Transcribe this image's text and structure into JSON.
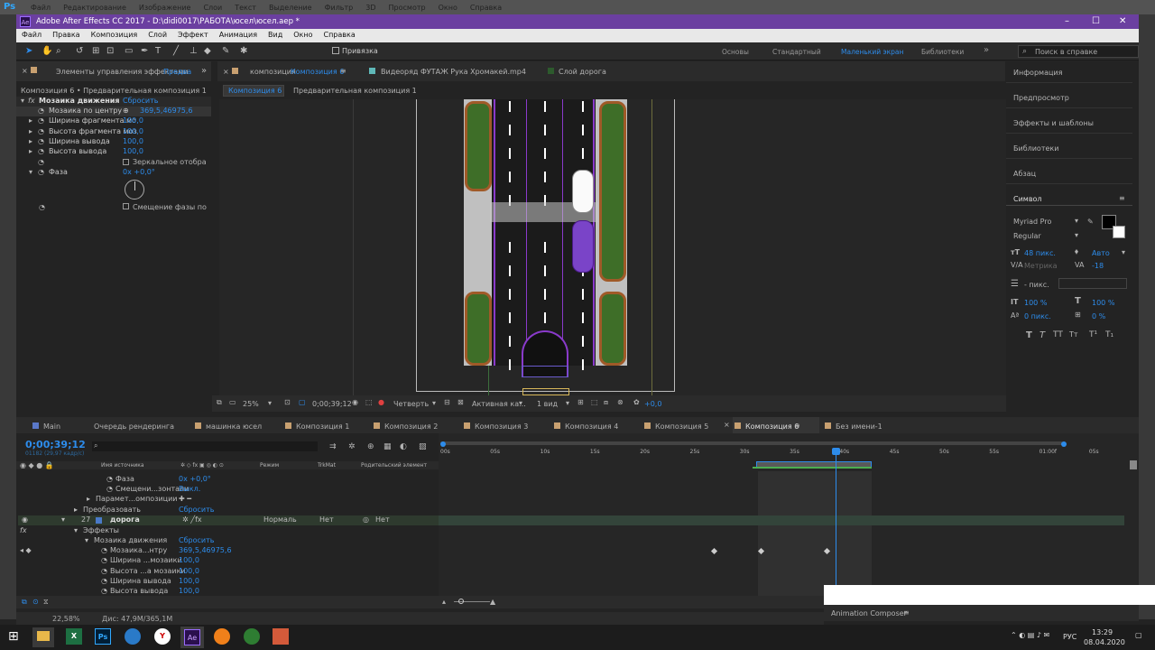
{
  "ps": {
    "logo": "Ps",
    "menu": [
      "Файл",
      "Редактирование",
      "Изображение",
      "Слои",
      "Текст",
      "Выделение",
      "Фильтр",
      "3D",
      "Просмотр",
      "Окно",
      "Справка"
    ]
  },
  "window": {
    "app_badge": "Ae",
    "title": "Adobe After Effects CC 2017 - D:\\didi0017\\РАБОТА\\юсел\\юсел.aep *"
  },
  "menu": [
    "Файл",
    "Правка",
    "Композиция",
    "Слой",
    "Эффект",
    "Анимация",
    "Вид",
    "Окно",
    "Справка"
  ],
  "toolbar": {
    "snap": "Привязка",
    "workspaces": [
      "Основы",
      "Стандартный",
      "Маленький экран",
      "Библиотеки"
    ],
    "active_workspace": "Маленький экран",
    "search_placeholder": "Поиск в справке"
  },
  "effects_panel": {
    "tab": "Элементы управления эффектами",
    "tab_target": "Предва",
    "breadcrumb": "Композиция 6 • Предварительная композиция 1",
    "effect_name": "Мозаика движения",
    "reset": "Сбросить",
    "props": [
      {
        "name": "Мозаика по центру",
        "value": "369,5,46975,6"
      },
      {
        "name": "Ширина фрагмента мо",
        "value": "100,0"
      },
      {
        "name": "Высота фрагмента моз",
        "value": "100,0"
      },
      {
        "name": "Ширина вывода",
        "value": "100,0"
      },
      {
        "name": "Высота вывода",
        "value": "100,0"
      },
      {
        "name": "",
        "value": "Зеркальное отобра"
      },
      {
        "name": "Фаза",
        "value": "0x +0,0°"
      }
    ],
    "phase_shift": "Смещение фазы по"
  },
  "comp_tabs": {
    "composition": "композиция",
    "composition_name": "Композиция 6",
    "footage": "Видеоряд ФУТАЖ Рука Хромакей.mp4",
    "layer": "Слой дорога"
  },
  "breadcrumbs": [
    "Композиция 6",
    "Предварительная композиция 1"
  ],
  "viewer_controls": {
    "zoom": "25%",
    "timecode": "0;00;39;12",
    "resolution": "Четверть",
    "camera": "Активная ка...",
    "views": "1 вид",
    "exposure": "+0,0"
  },
  "right_panel": {
    "sections": [
      "Информация",
      "Предпросмотр",
      "Эффекты и шаблоны",
      "Библиотеки",
      "Абзац"
    ],
    "character_title": "Символ",
    "font": "Myriad Pro",
    "style": "Regular",
    "size": "48 пикс.",
    "leading": "Авто",
    "tracking_label": "Метрика",
    "tracking": "-18",
    "stroke": "- пикс.",
    "vscale": "100 %",
    "hscale": "100 %",
    "baseline": "0 пикс.",
    "tsume": "0 %"
  },
  "timeline_tabs": [
    "Main",
    "Очередь рендеринга",
    "машинка юсел",
    "Композиция 1",
    "Композиция 2",
    "Композиция 3",
    "Композиция 4",
    "Композиция 5",
    "Композиция 6",
    "Без имени-1"
  ],
  "timeline": {
    "timecode": "0;00;39;12",
    "subcode": "01182 (29,97 кадр/с)",
    "columns": [
      "Имя источника",
      "Режим",
      "TrkMat",
      "Родительский элемент"
    ],
    "ruler": [
      "00s",
      "05s",
      "10s",
      "15s",
      "20s",
      "25s",
      "30s",
      "35s",
      "40s",
      "45s",
      "50s",
      "55s",
      "01:00f",
      "05s"
    ],
    "layers": [
      {
        "label": "Фаза",
        "value": "0x +0,0°"
      },
      {
        "label": "Смещени...зонтали",
        "value": "Выкл."
      },
      {
        "label": "Парамет...омпозиции",
        "value": ""
      },
      {
        "label": "Преобразовать",
        "value": "Сбросить"
      },
      {
        "label": "дорога",
        "num": "27",
        "mode": "Нормаль",
        "trk": "Нет",
        "parent": "Нет"
      },
      {
        "label": "Эффекты",
        "value": ""
      },
      {
        "label": "Мозаика движения",
        "value": "Сбросить"
      },
      {
        "label": "Мозаика...нтру",
        "value": "369,5,46975,6"
      },
      {
        "label": "Ширина ...мозаики",
        "value": "100,0"
      },
      {
        "label": "Высота ...а мозаики",
        "value": "100,0"
      },
      {
        "label": "Ширина вывода",
        "value": "100,0"
      },
      {
        "label": "Высота вывода",
        "value": "100,0"
      }
    ]
  },
  "status": {
    "zoom": "22,58%",
    "memory": "Дис: 47,9М/365,1М"
  },
  "animation_composer": "Animation Composer",
  "taskbar": {
    "lang": "РУС",
    "time": "13:29",
    "date": "08.04.2020"
  }
}
